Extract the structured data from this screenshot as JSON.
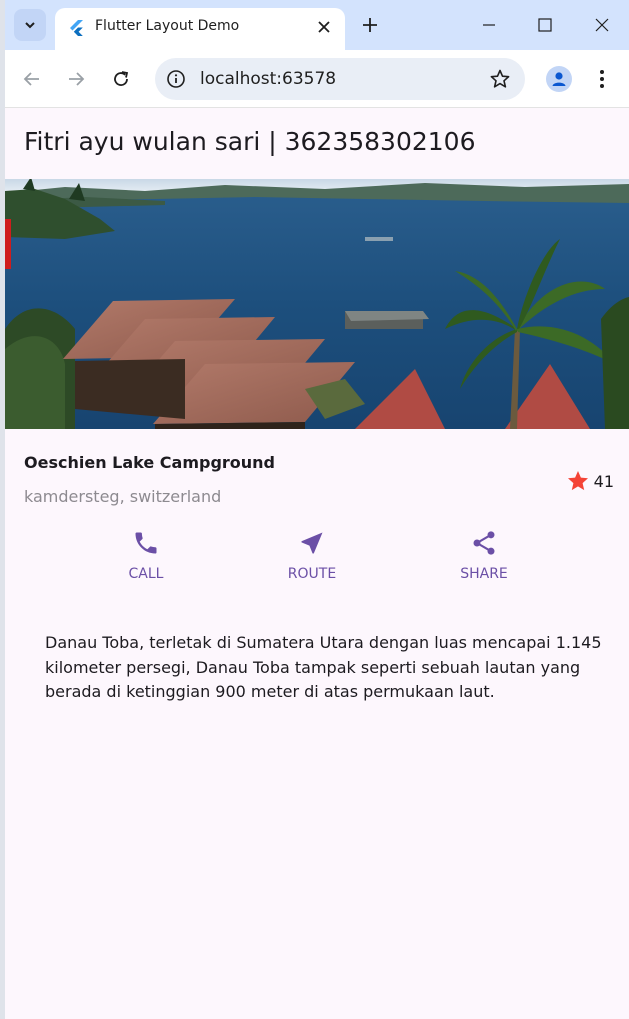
{
  "browser": {
    "tab_title": "Flutter Layout Demo",
    "url": "localhost:63578"
  },
  "app": {
    "title": "Fitri ayu wulan sari | 362358302106"
  },
  "place": {
    "name": "Oeschien Lake Campground",
    "location": "kamdersteg, switzerland",
    "rating_count": "41"
  },
  "actions": [
    {
      "label": "CALL",
      "icon": "phone-icon"
    },
    {
      "label": "ROUTE",
      "icon": "navigation-icon"
    },
    {
      "label": "SHARE",
      "icon": "share-icon"
    }
  ],
  "description": "Danau Toba, terletak di Sumatera Utara dengan luas mencapai 1.145 kilometer persegi, Danau Toba tampak seperti sebuah lautan yang berada di ketinggian 900 meter di atas permukaan laut.",
  "colors": {
    "accent": "#6b4fa6",
    "star": "#f44336",
    "page_bg": "#fdf7fd",
    "tabstrip": "#d3e3fd"
  }
}
